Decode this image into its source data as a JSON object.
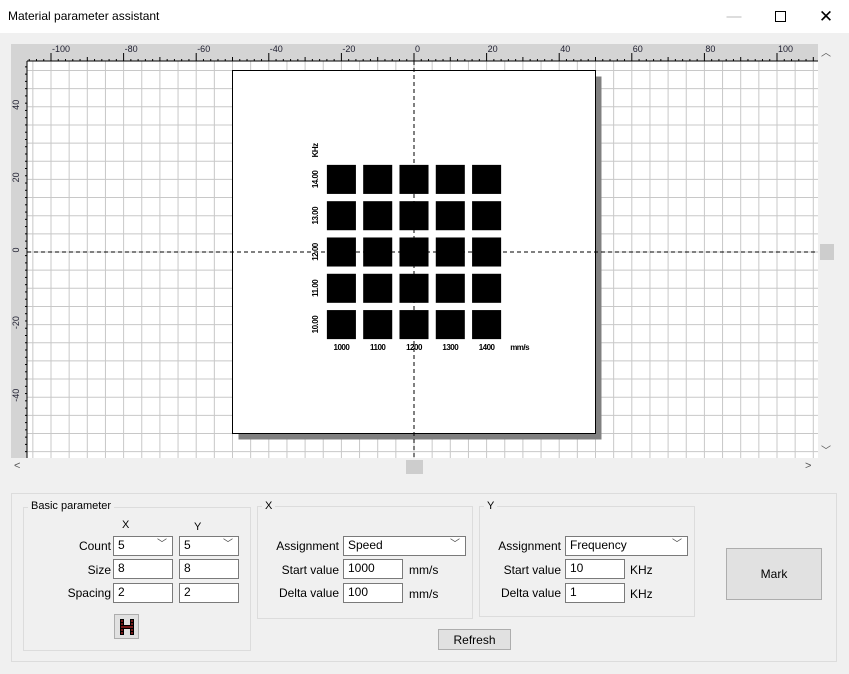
{
  "window": {
    "title": "Material parameter assistant",
    "minimize_icon": "minimize-icon",
    "maximize_icon": "maximize-icon",
    "close_icon": "close-icon"
  },
  "canvas": {
    "ruler_x_labels": [
      "-100",
      "-80",
      "-60",
      "-40",
      "-20",
      "0",
      "20",
      "40",
      "60",
      "80",
      "100"
    ],
    "ruler_y_labels": [
      "40",
      "20",
      "0",
      "-20",
      "-40"
    ],
    "x_labels": [
      "1000",
      "1100",
      "1200",
      "1300",
      "1400"
    ],
    "x_unit": "mm/s",
    "y_labels": [
      "14.00",
      "13.00",
      "12.00",
      "11.00",
      "10.00"
    ],
    "y_unit": "KHz",
    "colors": {
      "grid": "#c8c8c8",
      "tile": "#000000",
      "shadow": "#808080",
      "ruler": "#d4d4d4"
    }
  },
  "basic": {
    "title": "Basic parameter",
    "col_x": "X",
    "col_y": "Y",
    "count_label": "Count",
    "count_x": "5",
    "count_y": "5",
    "size_label": "Size",
    "size_x": "8",
    "size_y": "8",
    "spacing_label": "Spacing",
    "spacing_x": "2",
    "spacing_y": "2",
    "icon": "hatch-icon"
  },
  "xgroup": {
    "title": "X",
    "assignment_label": "Assignment",
    "assignment": "Speed",
    "start_label": "Start value",
    "start": "1000",
    "start_unit": "mm/s",
    "delta_label": "Delta value",
    "delta": "100",
    "delta_unit": "mm/s"
  },
  "ygroup": {
    "title": "Y",
    "assignment_label": "Assignment",
    "assignment": "Frequency",
    "start_label": "Start value",
    "start": "10",
    "start_unit": "KHz",
    "delta_label": "Delta value",
    "delta": "1",
    "delta_unit": "KHz"
  },
  "buttons": {
    "refresh": "Refresh",
    "mark": "Mark"
  }
}
